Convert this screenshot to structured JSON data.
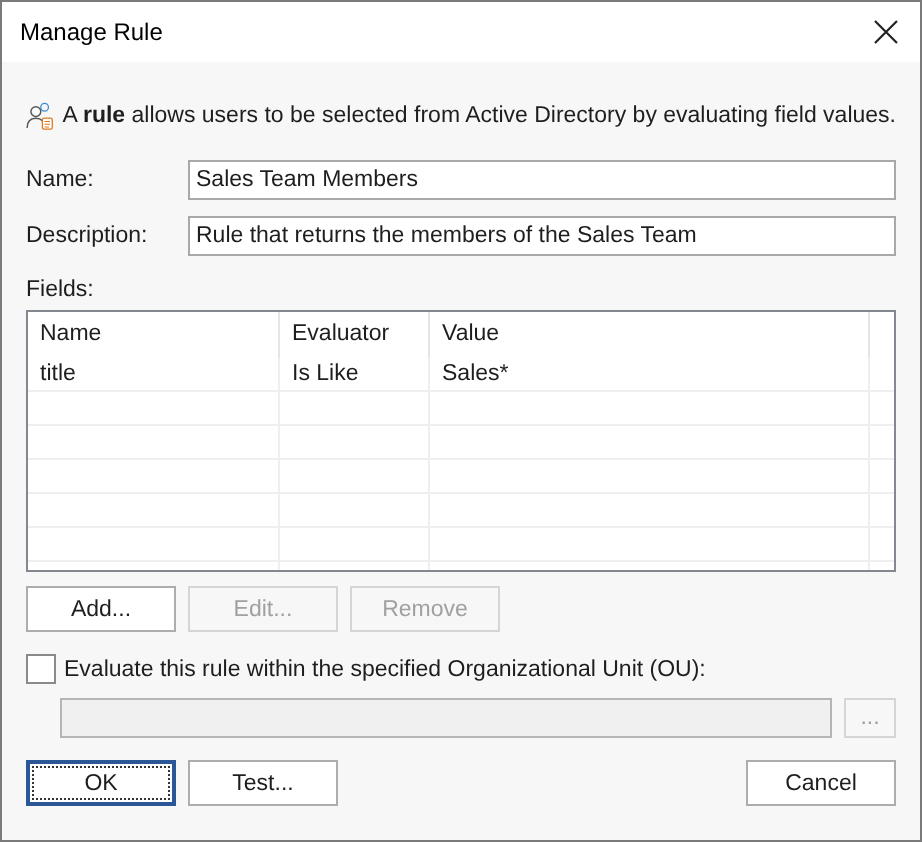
{
  "window": {
    "title": "Manage Rule"
  },
  "intro": "A **rule** allows users to be selected from Active Directory by evaluating field values.",
  "name": {
    "label": "Name:",
    "value": "Sales Team Members"
  },
  "description": {
    "label": "Description:",
    "value": "Rule that returns the members of the Sales Team"
  },
  "fields": {
    "label": "Fields:",
    "columns": [
      "Name",
      "Evaluator",
      "Value"
    ],
    "rows": [
      [
        "title",
        "Is Like",
        "Sales*"
      ]
    ]
  },
  "field_buttons": [
    {
      "label": "Add...",
      "disabled": false
    },
    {
      "label": "Edit...",
      "disabled": true
    },
    {
      "label": "Remove",
      "disabled": true
    }
  ],
  "ou": {
    "label": "Evaluate this rule within the specified Organizational Unit (OU):",
    "checked": false,
    "browse": "..."
  },
  "buttons": [
    {
      "label": "OK",
      "default": true
    },
    {
      "label": "Test...",
      "default": false
    },
    {
      "label": "Cancel",
      "default": false
    }
  ]
}
